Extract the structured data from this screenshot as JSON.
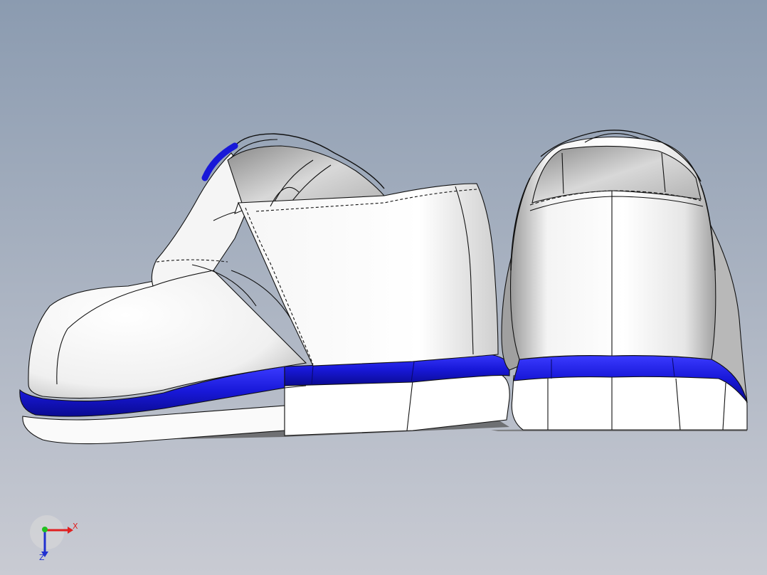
{
  "viewport": {
    "background_top": "#8b9bb0",
    "background_bottom": "#c9cbd3"
  },
  "model": {
    "body_color": "#ffffff",
    "accent_color": "#1818d8",
    "edge_color": "#111111"
  },
  "triad": {
    "x_label": "X",
    "z_label": "Z",
    "x_color": "#e02020",
    "y_color": "#20c020",
    "z_color": "#2030d0"
  }
}
